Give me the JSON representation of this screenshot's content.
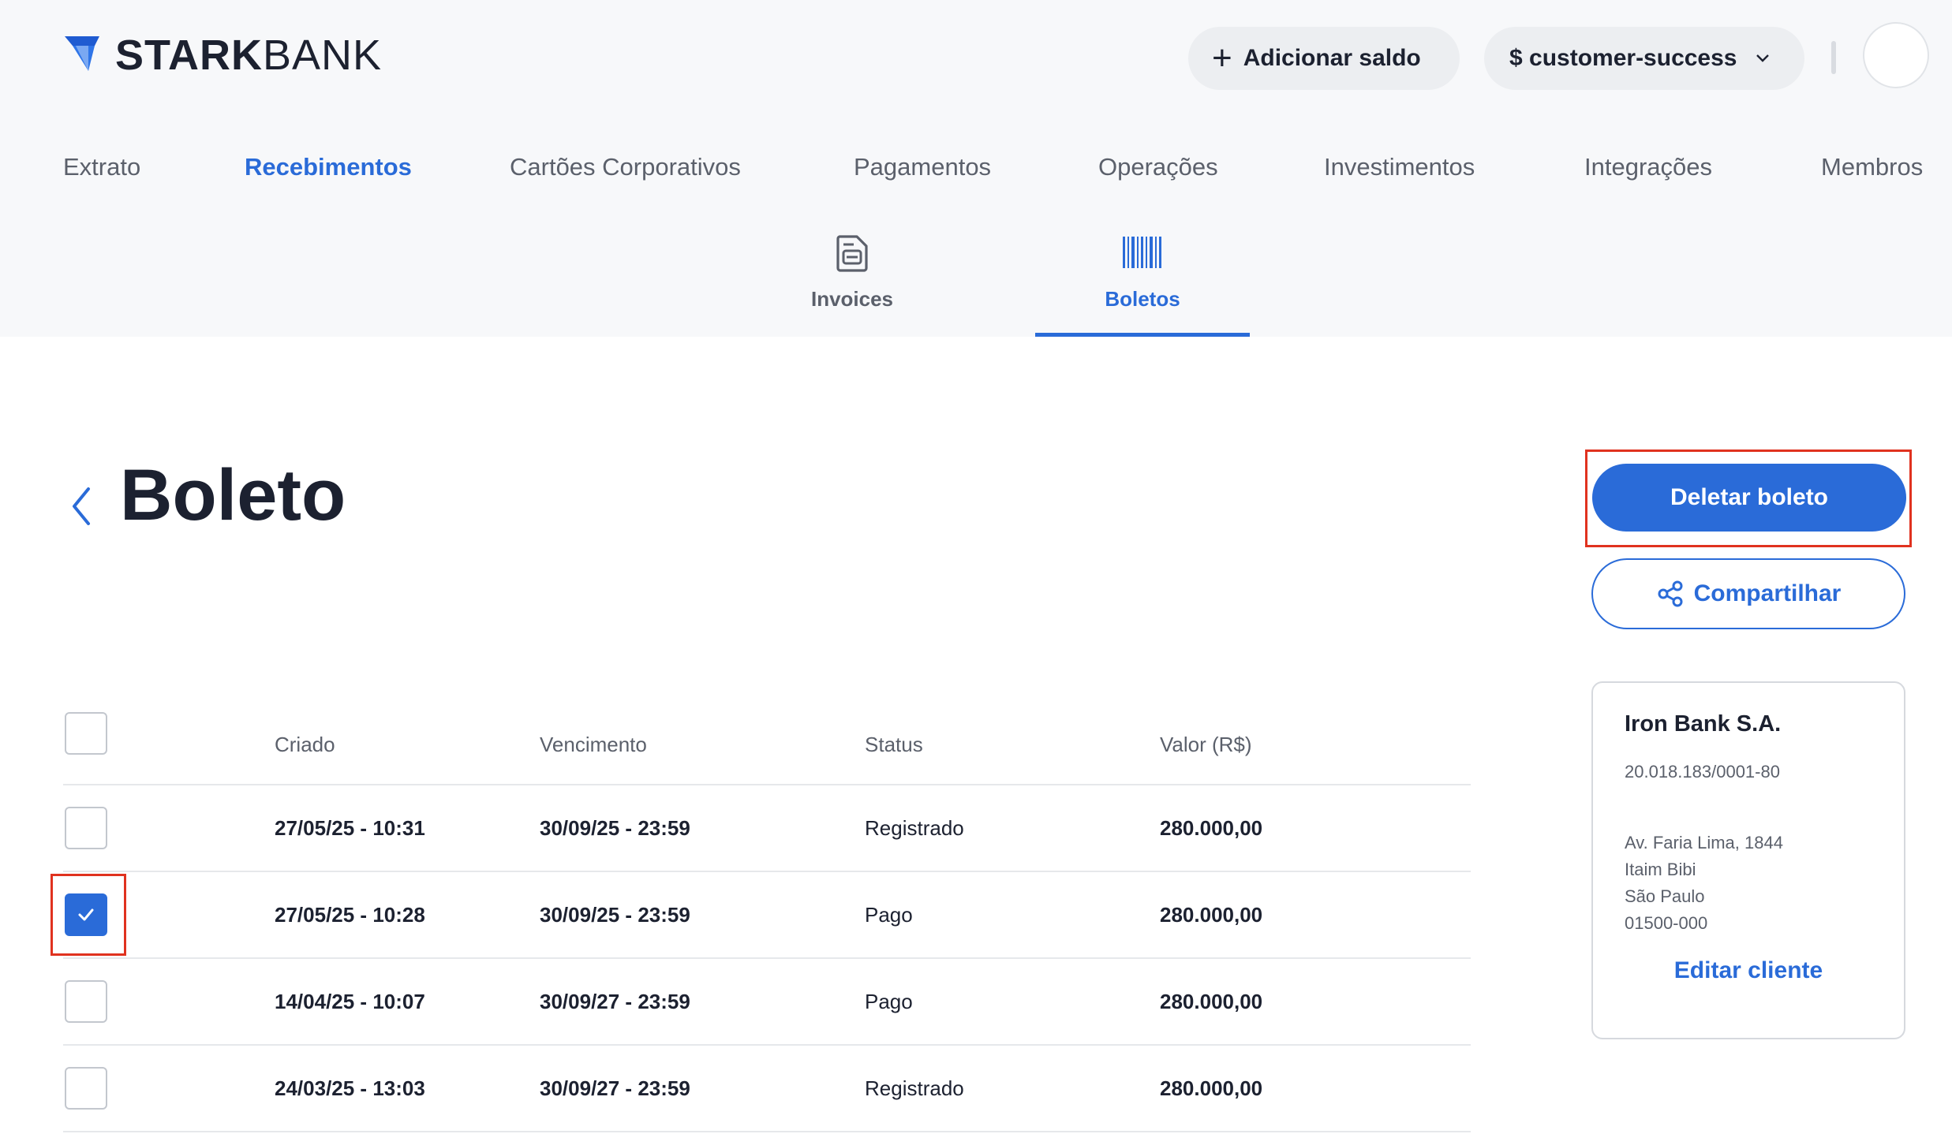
{
  "brand": {
    "part1": "STARK",
    "part2": "BANK"
  },
  "header": {
    "add_balance_label": "Adicionar saldo",
    "account_label": "$ customer-success"
  },
  "main_nav": [
    {
      "label": "Extrato",
      "active": false
    },
    {
      "label": "Recebimentos",
      "active": true
    },
    {
      "label": "Cartões Corporativos",
      "active": false
    },
    {
      "label": "Pagamentos",
      "active": false
    },
    {
      "label": "Operações",
      "active": false
    },
    {
      "label": "Investimentos",
      "active": false
    },
    {
      "label": "Integrações",
      "active": false
    },
    {
      "label": "Membros",
      "active": false
    }
  ],
  "sub_tabs": [
    {
      "label": "Invoices",
      "icon": "invoice-document-icon",
      "active": false
    },
    {
      "label": "Boletos",
      "icon": "barcode-icon",
      "active": true
    }
  ],
  "page": {
    "title": "Boleto"
  },
  "actions": {
    "delete_label": "Deletar boleto",
    "share_label": "Compartilhar"
  },
  "table": {
    "headers": {
      "created": "Criado",
      "due": "Vencimento",
      "status": "Status",
      "value": "Valor (R$)"
    },
    "rows": [
      {
        "created": "27/05/25 - 10:31",
        "due": "30/09/25 - 23:59",
        "status": "Registrado",
        "value": "280.000,00",
        "checked": false
      },
      {
        "created": "27/05/25 - 10:28",
        "due": "30/09/25 - 23:59",
        "status": "Pago",
        "value": "280.000,00",
        "checked": true
      },
      {
        "created": "14/04/25 - 10:07",
        "due": "30/09/27 - 23:59",
        "status": "Pago",
        "value": "280.000,00",
        "checked": false
      },
      {
        "created": "24/03/25 - 13:03",
        "due": "30/09/27 - 23:59",
        "status": "Registrado",
        "value": "280.000,00",
        "checked": false
      }
    ]
  },
  "customer": {
    "name": "Iron Bank S.A.",
    "tax_id": "20.018.183/0001-80",
    "address_line1": "Av. Faria Lima, 1844",
    "address_line2": "Itaim Bibi",
    "city": "São Paulo",
    "zip": "01500-000",
    "edit_label": "Editar cliente"
  },
  "colors": {
    "accent": "#2a6bd8",
    "highlight": "#e0321f",
    "header_bg": "#f7f8fa"
  }
}
